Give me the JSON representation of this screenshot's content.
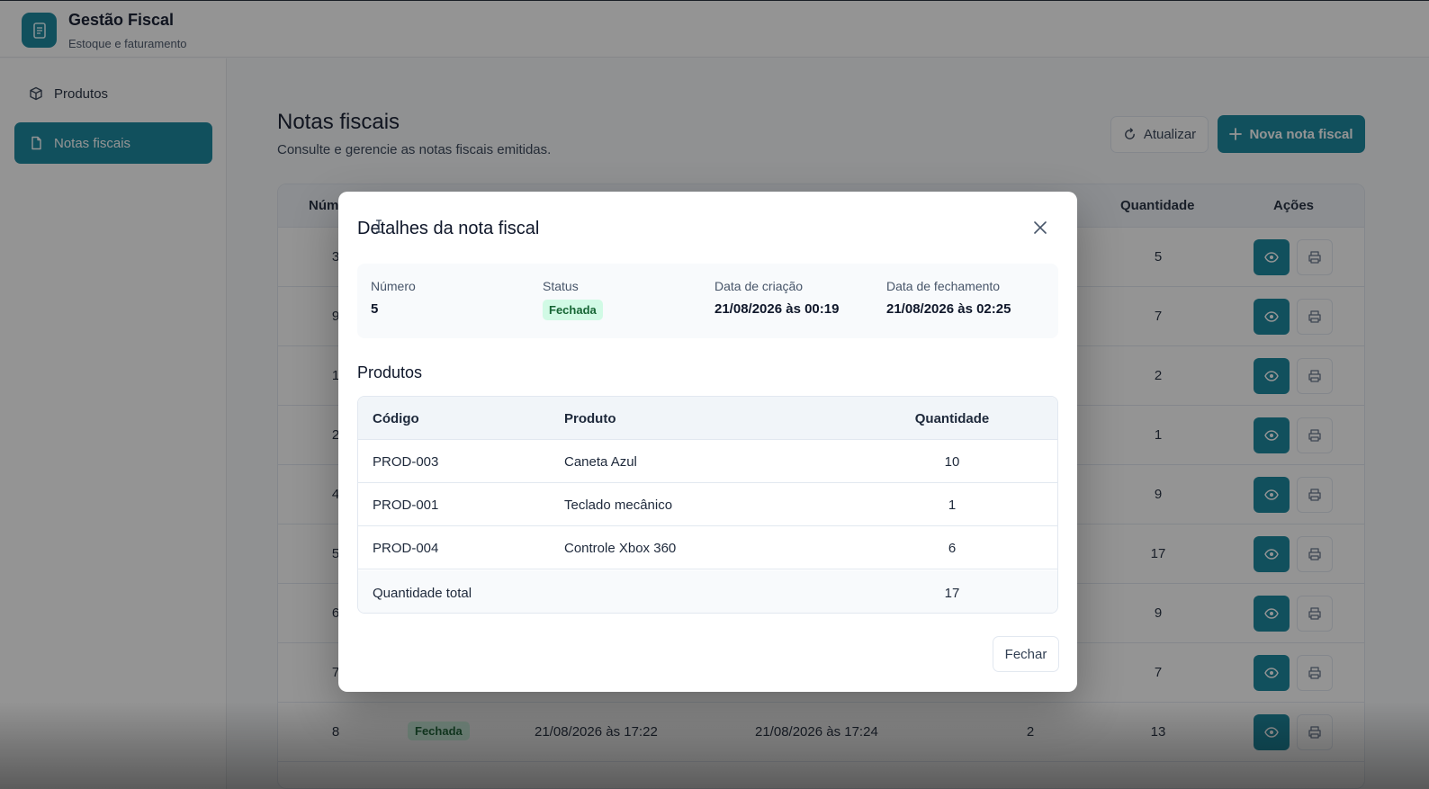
{
  "app": {
    "title": "Gestão Fiscal",
    "subtitle": "Estoque e faturamento",
    "accent_color": "#12849c"
  },
  "sidebar": {
    "items": [
      {
        "label": "Produtos",
        "icon": "box-icon",
        "active": false
      },
      {
        "label": "Notas fiscais",
        "icon": "file-icon",
        "active": true
      }
    ]
  },
  "page": {
    "title": "Notas fiscais",
    "subtitle": "Consulte e gerencie as notas fiscais emitidas.",
    "refresh_label": "Atualizar",
    "new_label": "Nova nota fiscal"
  },
  "main_table": {
    "headers": {
      "numero": "Núm",
      "quantidade": "Quantidade",
      "acoes": "Ações"
    },
    "rows": [
      {
        "numero": "3",
        "quantidade": "5"
      },
      {
        "numero": "9",
        "quantidade": "7"
      },
      {
        "numero": "1",
        "quantidade": "2"
      },
      {
        "numero": "2",
        "quantidade": "1"
      },
      {
        "numero": "4",
        "quantidade": "9"
      },
      {
        "numero": "5",
        "quantidade": "17"
      },
      {
        "numero": "6",
        "quantidade": "9"
      },
      {
        "numero": "7",
        "quantidade": "7"
      },
      {
        "numero": "8",
        "status": "Fechada",
        "criacao": "21/08/2026 às 17:22",
        "fechamento": "21/08/2026 às 17:24",
        "itens": "2",
        "quantidade": "13"
      }
    ]
  },
  "modal": {
    "title": "Detalhes da nota fiscal",
    "info": {
      "numero_label": "Número",
      "numero_value": "5",
      "status_label": "Status",
      "status_value": "Fechada",
      "criacao_label": "Data de criação",
      "criacao_value": "21/08/2026 às 00:19",
      "fechamento_label": "Data de fechamento",
      "fechamento_value": "21/08/2026 às 02:25"
    },
    "products_title": "Produtos",
    "products_table": {
      "headers": {
        "codigo": "Código",
        "produto": "Produto",
        "quantidade": "Quantidade"
      },
      "rows": [
        {
          "codigo": "PROD-003",
          "produto": "Caneta Azul",
          "quantidade": "10"
        },
        {
          "codigo": "PROD-001",
          "produto": "Teclado mecânico",
          "quantidade": "1"
        },
        {
          "codigo": "PROD-004",
          "produto": "Controle Xbox 360",
          "quantidade": "6"
        }
      ],
      "total_label": "Quantidade total",
      "total_value": "17"
    },
    "close_label": "Fechar"
  }
}
